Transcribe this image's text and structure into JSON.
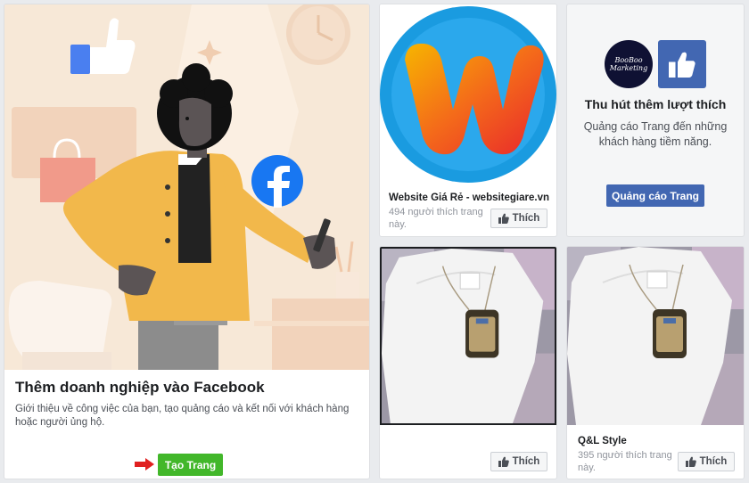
{
  "business_card": {
    "title": "Thêm doanh nghiệp vào Facebook",
    "description": "Giới thiệu về công việc của bạn, tạo quảng cáo và kết nối với khách hàng hoặc người ủng hộ.",
    "button_label": "Tạo Trang",
    "button_color": "#42b72a",
    "arrow_color": "#e02020"
  },
  "promo_page": {
    "name": "Website Giá Rẻ - websitegiare.vn",
    "likes": "494 người thích trang này.",
    "like_label": "Thích",
    "logo_letter": "W"
  },
  "likes_card": {
    "logo_line1": "BooBoo",
    "logo_line2": "Marketing",
    "title": "Thu hút thêm lượt thích",
    "description": "Quảng cáo Trang đến những khách hàng tiềm năng.",
    "button_label": "Quảng cáo Trang",
    "accent": "#4267b2"
  },
  "products": [
    {
      "name": "",
      "likes": "",
      "like_label": "Thích"
    },
    {
      "name": "Q&L Style",
      "likes": "395 người thích trang này.",
      "like_label": "Thích"
    }
  ]
}
